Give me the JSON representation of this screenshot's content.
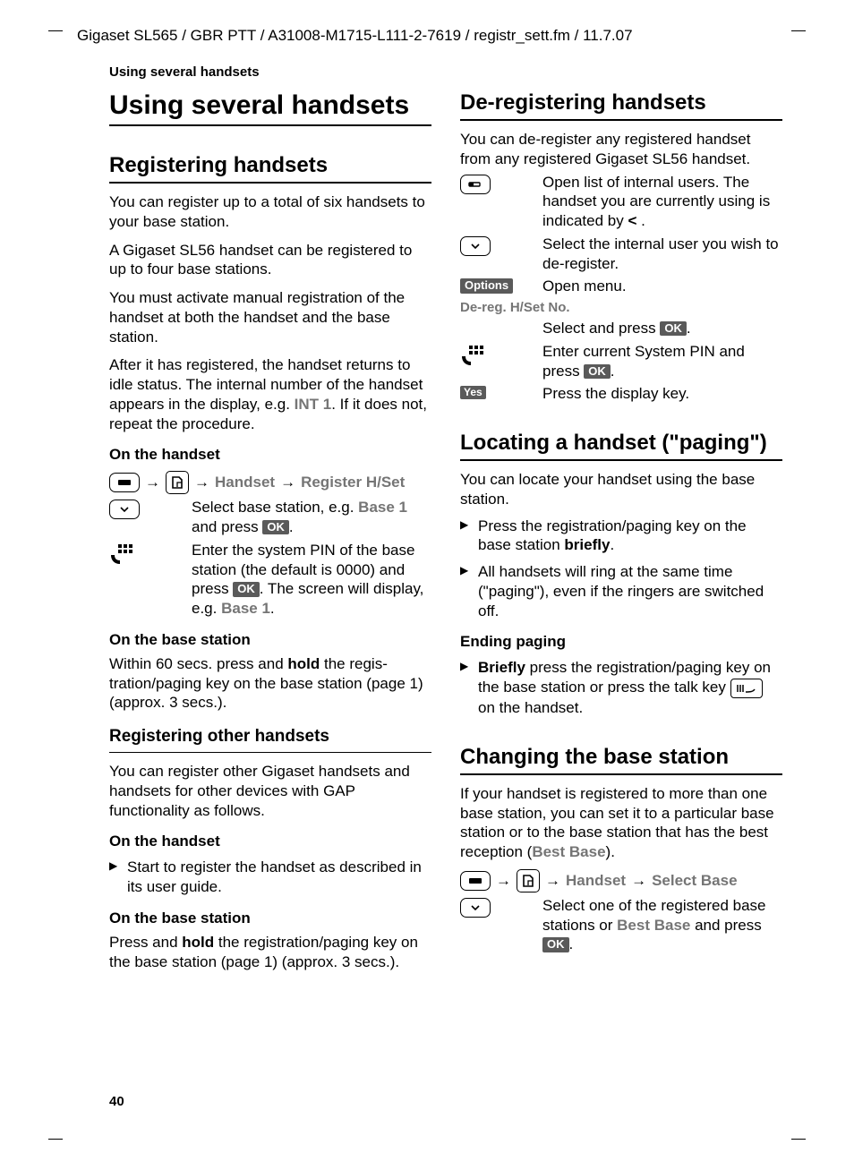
{
  "running_head": "Gigaset SL565 / GBR PTT / A31008-M1715-L111-2-7619 / registr_sett.fm / 11.7.07",
  "section_header": "Using several handsets",
  "page_number": "40",
  "col1": {
    "h1": "Using several handsets",
    "reg": {
      "title": "Registering handsets",
      "p1": "You can register up to a total of six hand­sets to your base station.",
      "p2": "A Gigaset SL56 handset can be registered to up to four base stations.",
      "p3": "You must activate manual registration of the handset at both the handset and the base station.",
      "p4a": "After it has registered, the handset returns to idle status. The internal number of the handset appears in the display, e.g. ",
      "p4b": "INT 1",
      "p4c": ". If it does not, repeat the procedure.",
      "on_handset": "On the handset",
      "menu1": "Handset",
      "menu2": "Register H/Set",
      "step1a": "Select base station, e.g. ",
      "step1b": "Base 1",
      "step1c": " and press ",
      "step2a": "Enter the system PIN of the base station (the default is 0000) and press ",
      "step2b": ". The screen will display, e.g. ",
      "step2c": "Base 1",
      "on_base": "On the base station",
      "base_p_a": "Within 60 secs. press and ",
      "base_p_hold": "hold",
      "base_p_b": " the regis­tration/paging key on the base station (page 1) (approx. 3 secs.)."
    },
    "other": {
      "title": "Registering other handsets",
      "p1": "You can register other Gigaset handsets and handsets for other devices with GAP functionality as follows.",
      "on_handset": "On the handset",
      "li1": "Start to register the handset as described in its user guide.",
      "on_base": "On the base station",
      "base_p_a": "Press and ",
      "base_p_hold": "hold",
      "base_p_b": " the registration/paging key on the base station (page 1) (approx. 3 secs.)."
    }
  },
  "col2": {
    "dereg": {
      "title": "De-registering handsets",
      "p1": "You can de-register any registered handset from any registered Gigaset SL56 handset.",
      "s1a": "Open list of internal users. The handset you are currently using is indicated by ",
      "s1b": "<",
      "s1c": " .",
      "s2": "Select the internal user you wish to de-register.",
      "options": "Options",
      "s3": "Open menu.",
      "dereg_label": "De-reg. H/Set No.",
      "s4a": "Select and press ",
      "s5a": "Enter current System PIN and press ",
      "yes": "Yes",
      "s6": "Press the display key."
    },
    "paging": {
      "title": "Locating a handset (\"paging\")",
      "p1": "You can locate your handset using the base station.",
      "li1a": "Press the registration/paging key on the base station ",
      "li1b": "briefly",
      "li2": "All handsets will ring at the same time (\"paging\"), even if the ringers are switched off.",
      "ending": "Ending paging",
      "li3a": "Briefly",
      "li3b": " press the registration/paging key on the base station or press the talk key ",
      "li3c": " on the handset."
    },
    "changing": {
      "title": "Changing the base station",
      "p1a": "If your handset is registered to more than one base station, you can set it to a partic­ular base station or to the base station that has the best reception (",
      "p1b": "Best Base",
      "p1c": ").",
      "menu1": "Handset",
      "menu2": "Select Base",
      "s1a": "Select one of the registered base stations or ",
      "s1b": "Best Base",
      "s1c": " and press "
    }
  },
  "labels": {
    "ok": "OK"
  }
}
